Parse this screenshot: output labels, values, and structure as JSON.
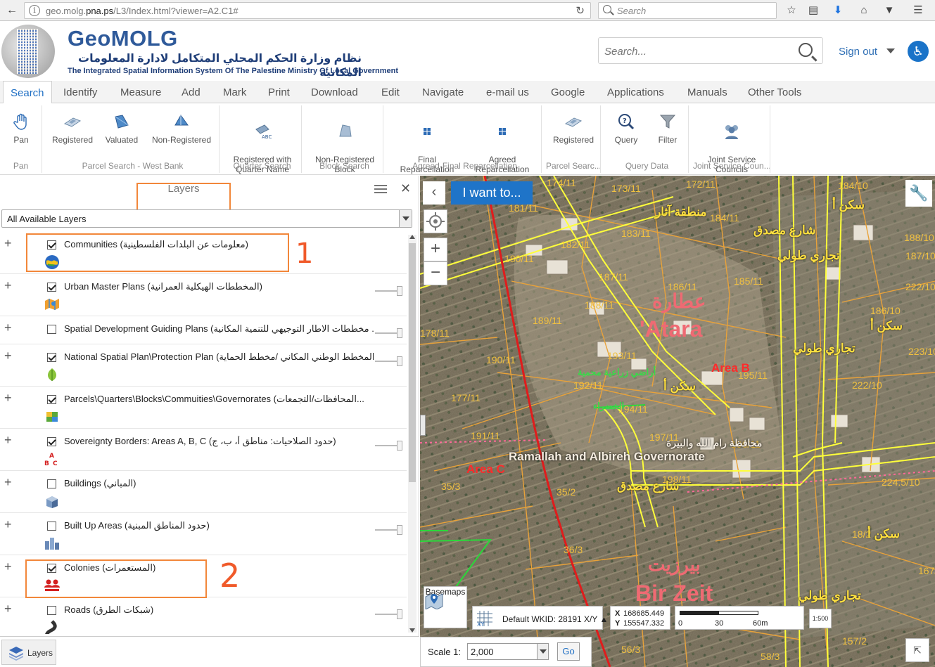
{
  "browser": {
    "url_prefix": "geo.molg.",
    "url_host": "pna.ps",
    "url_suffix": "/L3/Index.html?viewer=A2.C1#",
    "search_placeholder": "Search"
  },
  "header": {
    "title": "GeoMOLG",
    "subtitle_ar": "نظام وزارة الحكم المحلي المتكامل لادارة المعلومات المكانية",
    "subtitle_en": "The Integrated Spatial Information System Of The Palestine Ministry Of Local Government",
    "search_placeholder": "Search...",
    "signout_label": "Sign out"
  },
  "tabs": [
    {
      "label": "Search",
      "active": true
    },
    {
      "label": "Identify"
    },
    {
      "label": "Measure"
    },
    {
      "label": "Add"
    },
    {
      "label": "Mark"
    },
    {
      "label": "Print"
    },
    {
      "label": "Download"
    },
    {
      "label": "Edit"
    },
    {
      "label": "Navigate"
    },
    {
      "label": "e-mail us"
    },
    {
      "label": "Google"
    },
    {
      "label": "Applications"
    },
    {
      "label": "Manuals"
    },
    {
      "label": "Other Tools"
    }
  ],
  "ribbon": {
    "groups": [
      {
        "title": "Pan",
        "buttons": [
          "Pan"
        ]
      },
      {
        "title": "Parcel Search - West Bank",
        "buttons": [
          "Registered",
          "Valuated",
          "Non-Registered"
        ]
      },
      {
        "title": "Quarter Search",
        "buttons": [
          "Registered with\nQuarter Name"
        ]
      },
      {
        "title": "Block Search",
        "buttons": [
          "Non-Registered\nBlock"
        ]
      },
      {
        "title": "Agreed-Final Reparcellation",
        "buttons": [
          "Final\nReparcellation",
          "Agreed\nReparcellation"
        ]
      },
      {
        "title": "Parcel Searc...",
        "buttons": [
          "Registered"
        ]
      },
      {
        "title": "Query Data",
        "buttons": [
          "Query",
          "Filter"
        ]
      },
      {
        "title": "Joint Service Coun...",
        "buttons": [
          "Joint Service\nCouncils"
        ]
      }
    ]
  },
  "panel": {
    "title": "Layers",
    "dropdown_value": "All Available Layers",
    "layers": [
      {
        "name": "Communities (معلومات عن البلدات الفلسطينية)",
        "checked": true,
        "slider": false,
        "icon": "globe-icon"
      },
      {
        "name": "Urban Master Plans (المخططات الهيكلية العمرانية)",
        "checked": true,
        "slider": true,
        "icon": "map-plan-icon"
      },
      {
        "name": "Spatial Development Guiding Plans (مخططات الاطار التوجيهي للتنمية المكانية ...",
        "checked": false,
        "slider": true,
        "icon": "none"
      },
      {
        "name": "National Spatial Plan\\Protection Plan (المخطط الوطني المكاني /مخطط الحماية ...",
        "checked": true,
        "slider": true,
        "icon": "leaf-icon"
      },
      {
        "name": "Parcels\\Quarters\\Blocks\\Commuities\\Governorates (المحافظات/التجمعات...",
        "checked": true,
        "slider": false,
        "icon": "parcel-map-icon"
      },
      {
        "name": "Sovereignty Borders: Areas A, B, C (حدود الصلاحيات: مناطق أ، ب، ج)",
        "checked": true,
        "slider": true,
        "icon": "abc-areas-icon"
      },
      {
        "name": "Buildings (المباني)",
        "checked": false,
        "slider": false,
        "icon": "building-icon"
      },
      {
        "name": "Built Up Areas (حدود المناطق المبنية)",
        "checked": false,
        "slider": true,
        "icon": "city-icon"
      },
      {
        "name": "Colonies (المستعمرات)",
        "checked": true,
        "slider": false,
        "icon": "colonies-icon"
      },
      {
        "name": "Roads (شبكات الطرق)",
        "checked": false,
        "slider": true,
        "icon": "road-icon"
      }
    ],
    "footer_tab": "Layers",
    "annotation_1": "1",
    "annotation_2": "2"
  },
  "map": {
    "iwant_label": "I want to...",
    "basemaps_label": "Basemaps",
    "wkid_label": "Default WKID: 28191 X/Y",
    "x_label": "X",
    "y_label": "Y",
    "x_value": "168685.449",
    "y_value": "155547.332",
    "scale_ticks": [
      "0",
      "30",
      "60m"
    ],
    "scale_button": "1:500",
    "scale_label": "Scale 1:",
    "scale_value": "2,000",
    "go_label": "Go",
    "parcel_labels": [
      "174/11",
      "173/11",
      "172/11",
      "184/10",
      "181/11",
      "184/11",
      "188/10",
      "183/11",
      "182/11",
      "187/10",
      "180/11",
      "187/11",
      "186/11",
      "185/11",
      "222/10",
      "188/11",
      "189/11",
      "186/10",
      "178/11",
      "223/10",
      "190/11",
      "193/11",
      "195/11",
      "222/10",
      "192/11",
      "177/11",
      "194/11",
      "191/11",
      "197/11",
      "196/11",
      "198/11",
      "224.5/10",
      "35/3",
      "35/2",
      "36/3",
      "18/2",
      "167/2",
      "56/3",
      "58/3",
      "157/2"
    ],
    "place_labels": {
      "atara_ar": "عطارة",
      "atara_en": "'Atara",
      "area_b": "Area B",
      "area_c": "Area C",
      "governorate": "Ramallah and Albireh Governorate",
      "governorate_ar": "محافظة رام الله والبيرة",
      "birzeit_ar": "بيرزيت",
      "birzeit_en": "Bir Zeit",
      "antiquities": "منطقة آثار",
      "street_1": "شارع مصدق",
      "street_2": "تجاري طولي",
      "housing_1": "سكن أ",
      "housing_2": "سكن أ",
      "housing_3": "سكن أ",
      "commercial_1": "تجاري طولي",
      "commercial_2": "تجاري طولي",
      "street_3": "شارع مصدق",
      "housing_4": "سكن أ",
      "agri": "أراضي زراعية محمية",
      "vegetables": "الخضراء"
    }
  }
}
